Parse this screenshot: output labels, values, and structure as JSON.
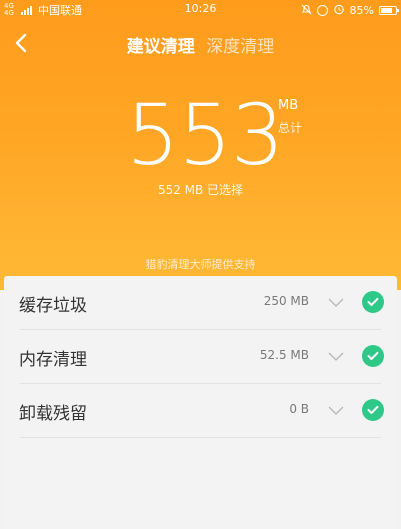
{
  "status_bar": {
    "signal_label": "4G 4G",
    "carrier": "中国联通",
    "time": "10:26",
    "battery": "85%",
    "icons": [
      "alarm-off-icon",
      "location-icon",
      "alarm-icon",
      "battery-icon"
    ]
  },
  "nav": {
    "back_icon": "chevron-left-icon",
    "tabs": [
      {
        "label": "建议清理",
        "active": true
      },
      {
        "label": "深度清理",
        "active": false
      }
    ]
  },
  "summary": {
    "size_value": "553",
    "size_unit": "MB",
    "total_label": "总计",
    "selected_text": "552 MB 已选择",
    "powered_by": "猎豹清理大师提供支持"
  },
  "items": [
    {
      "label": "缓存垃圾",
      "size": "250 MB",
      "checked": true
    },
    {
      "label": "内存清理",
      "size": "52.5 MB",
      "checked": true
    },
    {
      "label": "卸载残留",
      "size": "0 B",
      "checked": true
    }
  ],
  "colors": {
    "header_top": "#ff9c1c",
    "header_bottom": "#ffb935",
    "check_green": "#2ec889",
    "list_background": "#f3f3f3"
  }
}
